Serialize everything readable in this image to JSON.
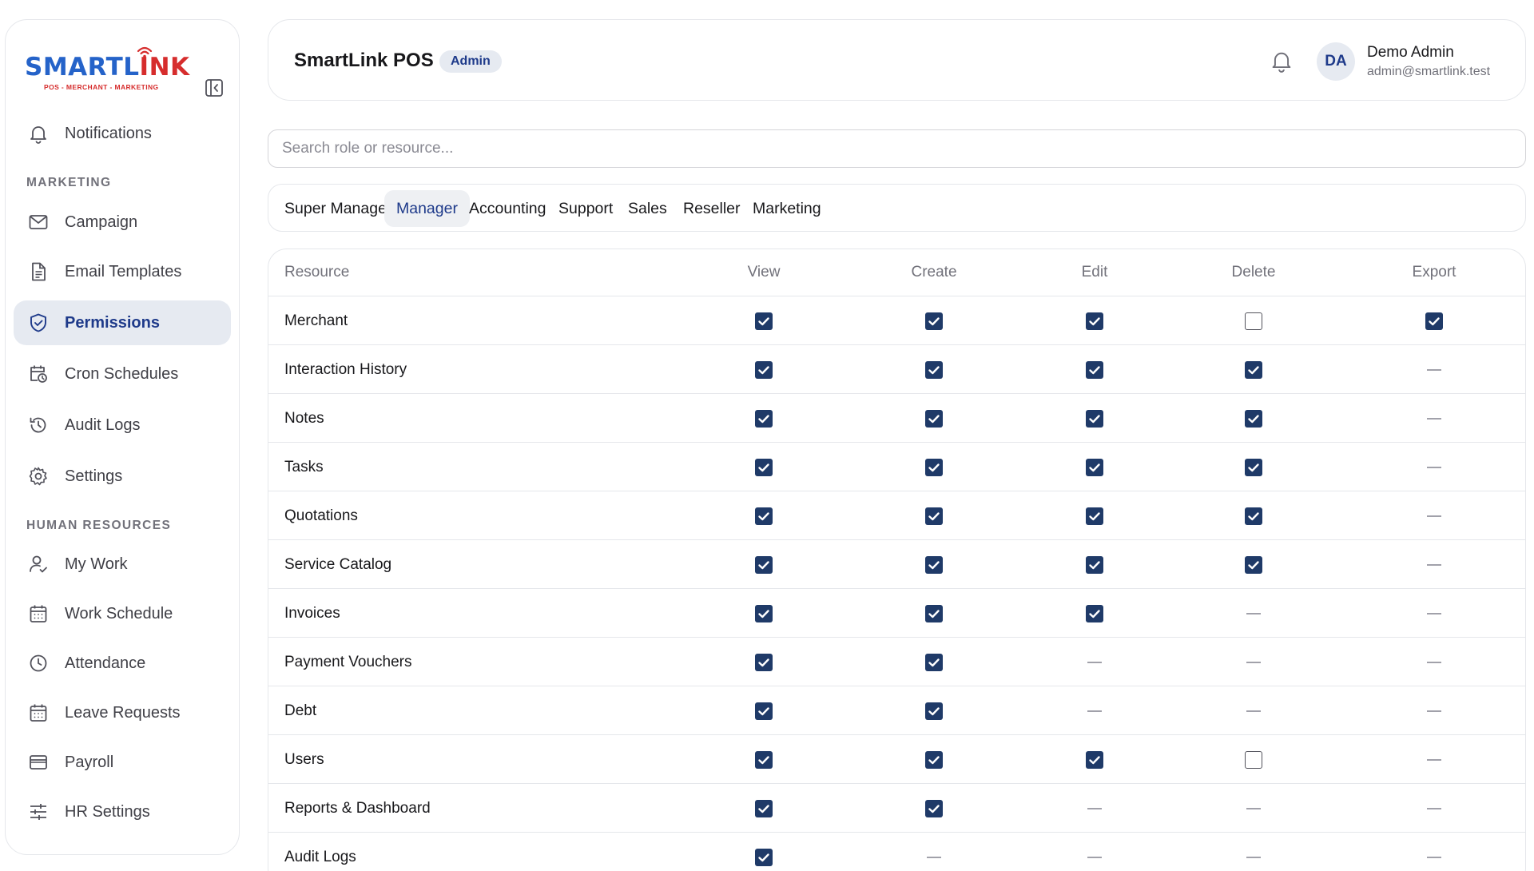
{
  "brand": {
    "word_1": "SMARTL",
    "word_2": "INK",
    "tagline": "POS - MERCHANT - MARKETING"
  },
  "sidebar": {
    "items": [
      {
        "label": "Notifications",
        "icon": "bell-icon"
      },
      {
        "label": "Campaign",
        "icon": "mail-icon"
      },
      {
        "label": "Email Templates",
        "icon": "document-icon"
      },
      {
        "label": "Permissions",
        "icon": "shield-icon",
        "active": true
      },
      {
        "label": "Cron Schedules",
        "icon": "calendar-clock-icon"
      },
      {
        "label": "Audit Logs",
        "icon": "history-icon"
      },
      {
        "label": "Settings",
        "icon": "gear-icon"
      },
      {
        "label": "My Work",
        "icon": "user-check-icon"
      },
      {
        "label": "Work Schedule",
        "icon": "calendar-icon"
      },
      {
        "label": "Attendance",
        "icon": "clock-icon"
      },
      {
        "label": "Leave Requests",
        "icon": "calendar-icon"
      },
      {
        "label": "Payroll",
        "icon": "wallet-icon"
      },
      {
        "label": "HR Settings",
        "icon": "sliders-icon"
      }
    ],
    "sections": {
      "marketing": "MARKETING",
      "hr": "HUMAN RESOURCES"
    }
  },
  "header": {
    "title": "SmartLink POS",
    "badge": "Admin",
    "user": {
      "initials": "DA",
      "name": "Demo Admin",
      "email": "admin@smartlink.test"
    }
  },
  "search": {
    "placeholder": "Search role or resource..."
  },
  "tabs": [
    "Super Manager",
    "Manager",
    "Accounting",
    "Support",
    "Sales",
    "Reseller",
    "Marketing"
  ],
  "active_tab": "Manager",
  "table": {
    "columns": [
      "Resource",
      "View",
      "Create",
      "Edit",
      "Delete",
      "Export"
    ],
    "rows": [
      {
        "resource": "Merchant",
        "perms": [
          "on",
          "on",
          "on",
          "off",
          "on"
        ]
      },
      {
        "resource": "Interaction History",
        "perms": [
          "on",
          "on",
          "on",
          "on",
          "na"
        ]
      },
      {
        "resource": "Notes",
        "perms": [
          "on",
          "on",
          "on",
          "on",
          "na"
        ]
      },
      {
        "resource": "Tasks",
        "perms": [
          "on",
          "on",
          "on",
          "on",
          "na"
        ]
      },
      {
        "resource": "Quotations",
        "perms": [
          "on",
          "on",
          "on",
          "on",
          "na"
        ]
      },
      {
        "resource": "Service Catalog",
        "perms": [
          "on",
          "on",
          "on",
          "on",
          "na"
        ]
      },
      {
        "resource": "Invoices",
        "perms": [
          "on",
          "on",
          "on",
          "na",
          "na"
        ]
      },
      {
        "resource": "Payment Vouchers",
        "perms": [
          "on",
          "on",
          "na",
          "na",
          "na"
        ]
      },
      {
        "resource": "Debt",
        "perms": [
          "on",
          "on",
          "na",
          "na",
          "na"
        ]
      },
      {
        "resource": "Users",
        "perms": [
          "on",
          "on",
          "on",
          "off",
          "na"
        ]
      },
      {
        "resource": "Reports & Dashboard",
        "perms": [
          "on",
          "on",
          "na",
          "na",
          "na"
        ]
      },
      {
        "resource": "Audit Logs",
        "perms": [
          "on",
          "na",
          "na",
          "na",
          "na"
        ]
      }
    ]
  },
  "colors": {
    "accent": "#1e3a8a",
    "checkbox": "#1f3a68",
    "active_bg": "#e6eaf1",
    "logo_blue": "#2563c9",
    "logo_red": "#d62d2d"
  }
}
